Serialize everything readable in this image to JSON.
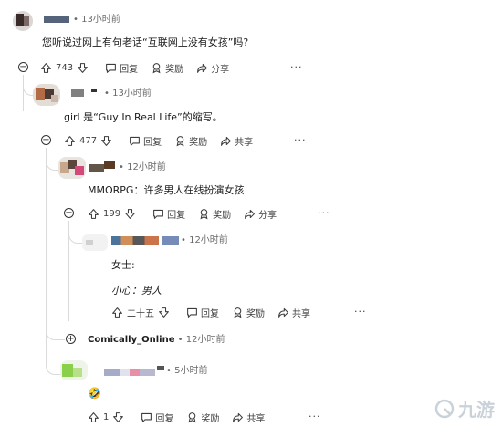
{
  "comments": [
    {
      "username": "",
      "timestamp": "• 13小时前",
      "body": "您听说过网上有句老话“互联网上没有女孩”吗?",
      "votes": "743",
      "reply": "回复",
      "award": "奖励",
      "share": "分享",
      "more": "···"
    },
    {
      "username": "",
      "timestamp": "• 13小时前",
      "body": "girl 是“Guy In Real Life”的缩写。",
      "votes": "477",
      "reply": "回复",
      "award": "奖励",
      "share": "共享",
      "more": "···"
    },
    {
      "username": "",
      "timestamp": "• 12小时前",
      "body": "MMORPG：许多男人在线扮演女孩",
      "votes": "199",
      "reply": "回复",
      "award": "奖励",
      "share": "分享",
      "more": "···"
    },
    {
      "username": "",
      "timestamp": "• 12小时前",
      "body_line1": "女士:",
      "body_line2": "小心：男人",
      "votes": "二十五",
      "reply": "回复",
      "award": "奖励",
      "share": "共享",
      "more": "···"
    },
    {
      "username": "Comically_Online",
      "timestamp": "• 12小时前"
    },
    {
      "username": "",
      "timestamp": "• 5小时前",
      "body_emoji": "🤣",
      "votes": "1",
      "reply": "回复",
      "award": "奖励",
      "share": "共享",
      "more": "···"
    }
  ],
  "watermark": {
    "text": "九游"
  },
  "icons": {
    "upvote": "upvote-icon",
    "downvote": "downvote-icon",
    "reply": "reply-bubble-icon",
    "award": "award-icon",
    "share": "share-arrow-icon",
    "collapse": "collapse-minus-icon",
    "expand": "expand-plus-icon"
  }
}
